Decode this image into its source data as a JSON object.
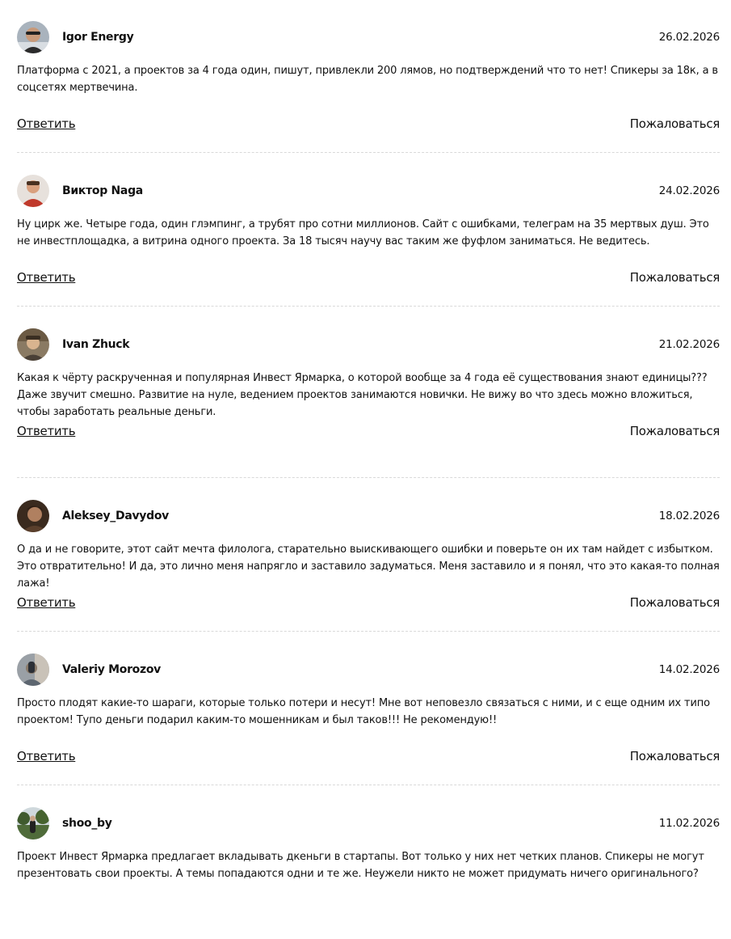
{
  "comments": [
    {
      "author": "Igor Energy",
      "date": "26.02.2026",
      "text": "Платформа с 2021, а проектов за 4 года один, пишут, привлекли 200 лямов, но подтверждений что то нет! Спикеры за 18к, а в соцсетях мертвечина.",
      "reply_label": "Ответить",
      "complain_label": "Пожаловаться",
      "avatar_colors": [
        "#9aa3ad",
        "#2b2b2b"
      ]
    },
    {
      "author": "Виктор Naga",
      "date": "24.02.2026",
      "text": "Ну цирк же. Четыре года, один глэмпинг, а трубят про сотни миллионов. Сайт с ошибками, телеграм на 35 мертвых душ. Это не инвестплощадка, а витрина одного проекта. За 18 тысяч научу вас таким же фуфлом заниматься. Не ведитесь.",
      "reply_label": "Ответить",
      "complain_label": "Пожаловаться",
      "avatar_colors": [
        "#c0392b",
        "#e8b59a"
      ]
    },
    {
      "author": "Ivan Zhuck",
      "date": "21.02.2026",
      "text": "Какая к чёрту раскрученная и популярная Инвест Ярмарка, о которой вообще за 4 года её существования знают единицы??? Даже звучит смешно. Развитие на нуле, ведением проектов занимаются новички. Не вижу во что здесь можно вложиться, чтобы заработать реальные деньги.",
      "reply_label": "Ответить",
      "complain_label": "Пожаловаться",
      "avatar_colors": [
        "#6b5a44",
        "#d9b48f"
      ]
    },
    {
      "author": "Aleksey_Davydov",
      "date": "18.02.2026",
      "text": "О да и не говорите, этот сайт мечта филолога, старательно выискивающего ошибки и поверьте он их там найдет с избытком. Это отвратительно! И да, это лично меня напрягло и заставило задуматься. Меня заставило и я понял, что это какая-то полная лажа!",
      "reply_label": "Ответить",
      "complain_label": "Пожаловаться",
      "avatar_colors": [
        "#3a2a1e",
        "#b08060"
      ]
    },
    {
      "author": "Valeriy Morozov",
      "date": "14.02.2026",
      "text": "Просто плодят какие-то шараги, которые только потери и несут! Мне вот неповезло связаться с ними, и с еще одним их типо проектом! Тупо деньги подарил каким-то мошенникам и был таков!!! Не рекомендую!!",
      "reply_label": "Ответить",
      "complain_label": "Пожаловаться",
      "avatar_colors": [
        "#8e9399",
        "#c9c2b8"
      ]
    },
    {
      "author": "shoo_by",
      "date": "11.02.2026",
      "text": "Проект Инвест Ярмарка предлагает вкладывать дкеньги в стартапы. Вот только у них нет четких планов. Спикеры не могут презентовать свои проекты. А темы попадаются одни и те же. Неужели никто не может придумать ничего оригинального?",
      "reply_label": "",
      "complain_label": "",
      "avatar_colors": [
        "#4f6b3a",
        "#222222"
      ]
    }
  ]
}
